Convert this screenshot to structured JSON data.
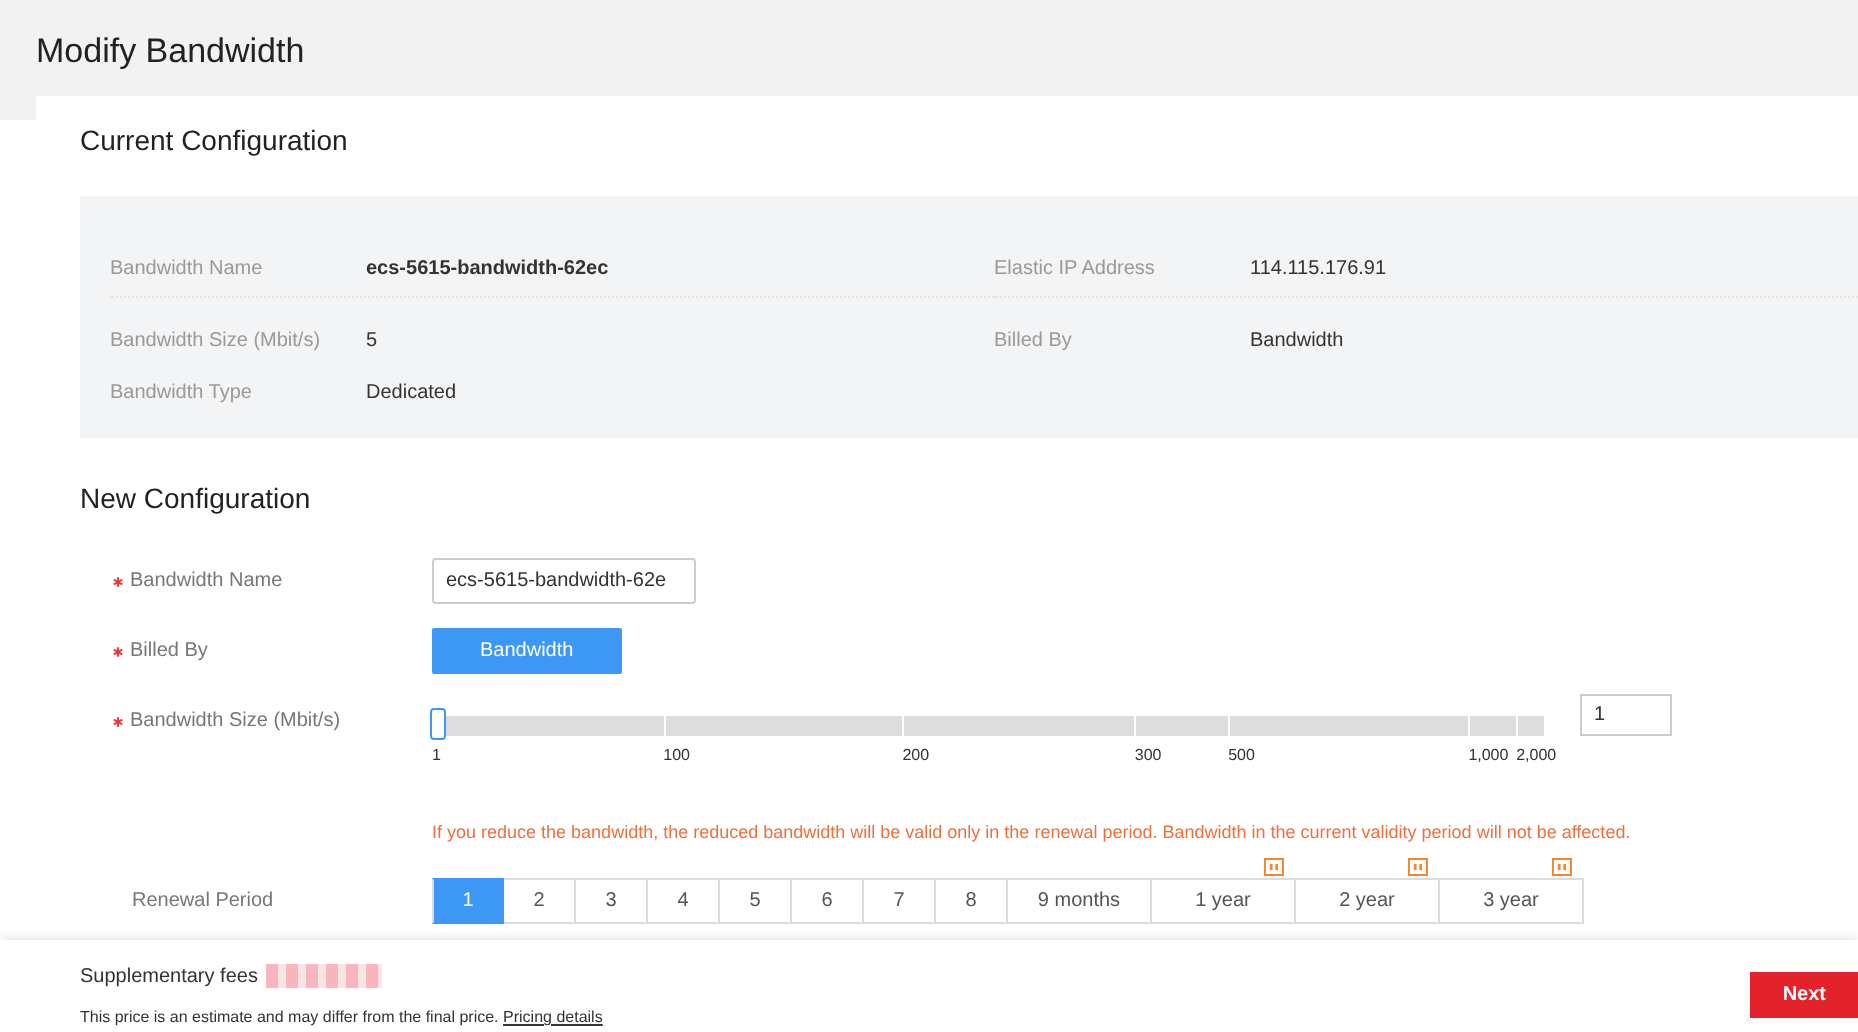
{
  "page": {
    "title": "Modify Bandwidth"
  },
  "current": {
    "heading": "Current Configuration",
    "fields": [
      {
        "label": "Bandwidth Name",
        "value": "ecs-5615-bandwidth-62ec",
        "bold": true
      },
      {
        "label": "Elastic IP Address",
        "value": "114.115.176.91",
        "bold": false
      },
      {
        "label": "Bandwidth Size (Mbit/s)",
        "value": "5",
        "bold": false
      },
      {
        "label": "Billed By",
        "value": "Bandwidth",
        "bold": false
      },
      {
        "label": "Bandwidth Type",
        "value": "Dedicated",
        "bold": false
      }
    ]
  },
  "new": {
    "heading": "New Configuration",
    "name": {
      "label": "Bandwidth Name",
      "required": true,
      "value": "ecs-5615-bandwidth-62e"
    },
    "billed_by": {
      "label": "Billed By",
      "required": true,
      "options": [
        {
          "label": "Bandwidth",
          "selected": true
        }
      ]
    },
    "size": {
      "label": "Bandwidth Size (Mbit/s)",
      "required": true,
      "level": 0,
      "ticks": [
        "1",
        "100",
        "200",
        "300",
        "500",
        "1,000",
        "2,000"
      ],
      "value": "1",
      "warning": "If you reduce the bandwidth, the reduced bandwidth will be valid only in the renewal period. Bandwidth in the current validity period will not be affected."
    },
    "renewal": {
      "label": "Renewal Period",
      "options": [
        {
          "label": "1",
          "selected": true,
          "discount": false
        },
        {
          "label": "2",
          "selected": false,
          "discount": false
        },
        {
          "label": "3",
          "selected": false,
          "discount": false
        },
        {
          "label": "4",
          "selected": false,
          "discount": false
        },
        {
          "label": "5",
          "selected": false,
          "discount": false
        },
        {
          "label": "6",
          "selected": false,
          "discount": false
        },
        {
          "label": "7",
          "selected": false,
          "discount": false
        },
        {
          "label": "8",
          "selected": false,
          "discount": false
        },
        {
          "label": "9 months",
          "selected": false,
          "discount": false
        },
        {
          "label": "1 year",
          "selected": false,
          "discount": true
        },
        {
          "label": "2 year",
          "selected": false,
          "discount": true
        },
        {
          "label": "3 year",
          "selected": false,
          "discount": true
        }
      ]
    }
  },
  "footer": {
    "fees_label": "Supplementary fees",
    "note": "This price is an estimate and may differ from the final price.",
    "link": "Pricing details",
    "next": "Next"
  }
}
